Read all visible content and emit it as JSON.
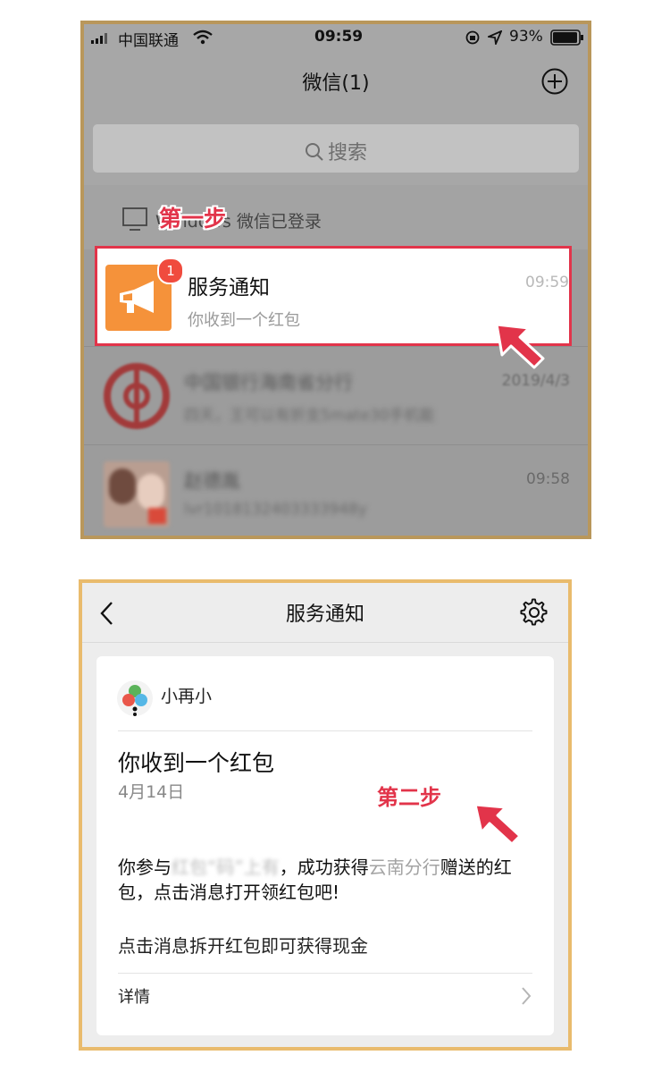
{
  "panel1": {
    "status": {
      "carrier": "中国联通",
      "time": "09:59",
      "battery": "93%"
    },
    "nav": {
      "title": "微信(1)"
    },
    "search": {
      "placeholder": "搜索"
    },
    "windows_row": {
      "text": "Windows 微信已登录"
    },
    "step_label": "第一步",
    "notify_row": {
      "name": "服务通知",
      "message": "你收到一个红包",
      "time": "09:59",
      "badge": "1"
    },
    "row2": {
      "name": "中国银行海南省分行",
      "message": "四天，王可以有折支5mate30手机能",
      "time": "2019/4/3"
    },
    "row3": {
      "name": "赵德胤",
      "message": "lvr1018132403333948y",
      "time": "09:58"
    }
  },
  "panel2": {
    "nav": {
      "title": "服务通知"
    },
    "card": {
      "sender": "小再小",
      "title": "你收到一个红包",
      "date": "4月14日",
      "body_prefix": "你参与",
      "body_blur": "红包“码”上有",
      "body_mid": "，成功获得",
      "body_grey": "云南分行",
      "body_suffix": "赠送的红包，点击消息打开领红包吧!",
      "line2": "点击消息拆开红包即可获得现金",
      "detail": "详情"
    },
    "step_label": "第二步"
  },
  "colors": {
    "highlight": "#e2344a",
    "notify_icon": "#f5923a",
    "badge": "#f04b3e"
  }
}
